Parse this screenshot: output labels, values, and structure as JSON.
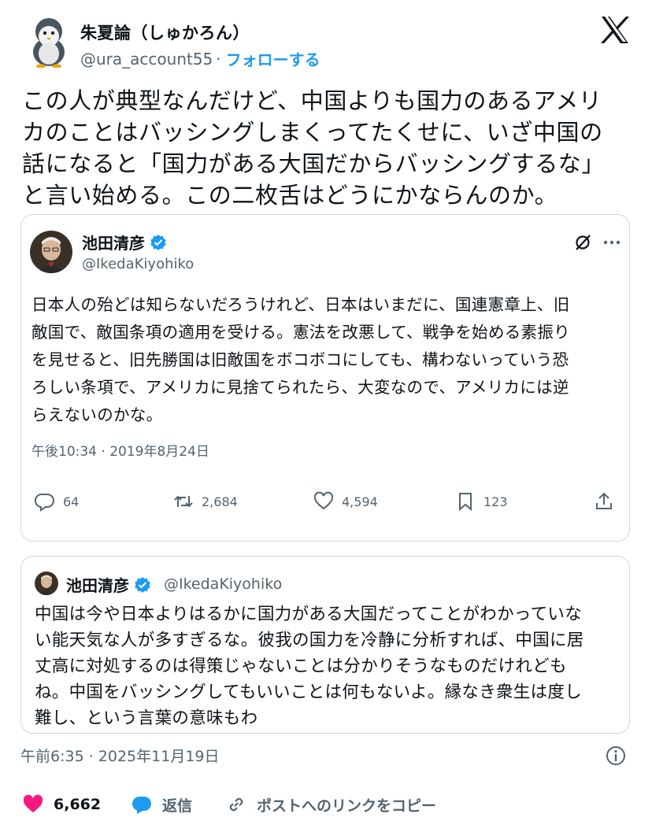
{
  "author": {
    "name": "朱夏論（しゅかろん）",
    "handle": "@ura_account55",
    "separator": "·",
    "follow_label": "フォローする"
  },
  "post_text": "この人が典型なんだけど、中国よりも国力のあるアメリ\nカのことはバッシングしまくってたくせに、いざ中国の\n話になると「国力がある大国だからバッシングするな」\nと言い始める。この二枚舌はどうにかならんのか。",
  "embedded_post": {
    "name": "池田清彦",
    "handle": "@IkedaKiyohiko",
    "text": "日本人の殆どは知らないだろうけれど、日本はいまだに、国連憲章上、旧\n敵国で、敵国条項の適用を受ける。憲法を改悪して、戦争を始める素振り\nを見せると、旧先勝国は旧敵国をボコボコにしても、構わないっていう恐\nろしい条項で、アメリカに見捨てられたら、大変なので、アメリカには逆\nらえないのかな。",
    "timestamp": "午後10:34 · 2019年8月24日",
    "stats": {
      "replies": "64",
      "retweets": "2,684",
      "likes": "4,594",
      "bookmarks": "123"
    }
  },
  "quoted_post": {
    "name": "池田清彦",
    "handle": "@IkedaKiyohiko",
    "text": "中国は今や日本よりはるかに国力がある大国だってことがわかっていな\nい能天気な人が多すぎるな。彼我の国力を冷静に分析すれば、中国に居\n丈高に対処するのは得策じゃないことは分かりそうなものだけれども\nね。中国をバッシングしてもいいことは何もないよ。縁なき衆生は度し\n難し、という言葉の意味もわ"
  },
  "post_timestamp": "午前6:35 · 2025年11月19日",
  "footer": {
    "like_count": "6,662",
    "reply_label": "返信",
    "copy_link_label": "ポストへのリンクをコピー"
  },
  "colors": {
    "accent": "#1d9bf0",
    "like": "#f91880",
    "text": "#0f1419",
    "secondary": "#536471",
    "border": "#cfd9de"
  },
  "icons": {
    "avatar": "penguin-avatar",
    "logo": "x-logo-icon",
    "verified": "verified-badge-icon",
    "grok": "grok-icon",
    "more": "more-icon",
    "reply": "reply-icon",
    "retweet": "retweet-icon",
    "like": "heart-icon",
    "bookmark": "bookmark-icon",
    "share": "share-icon",
    "info": "info-icon",
    "link": "link-icon"
  }
}
